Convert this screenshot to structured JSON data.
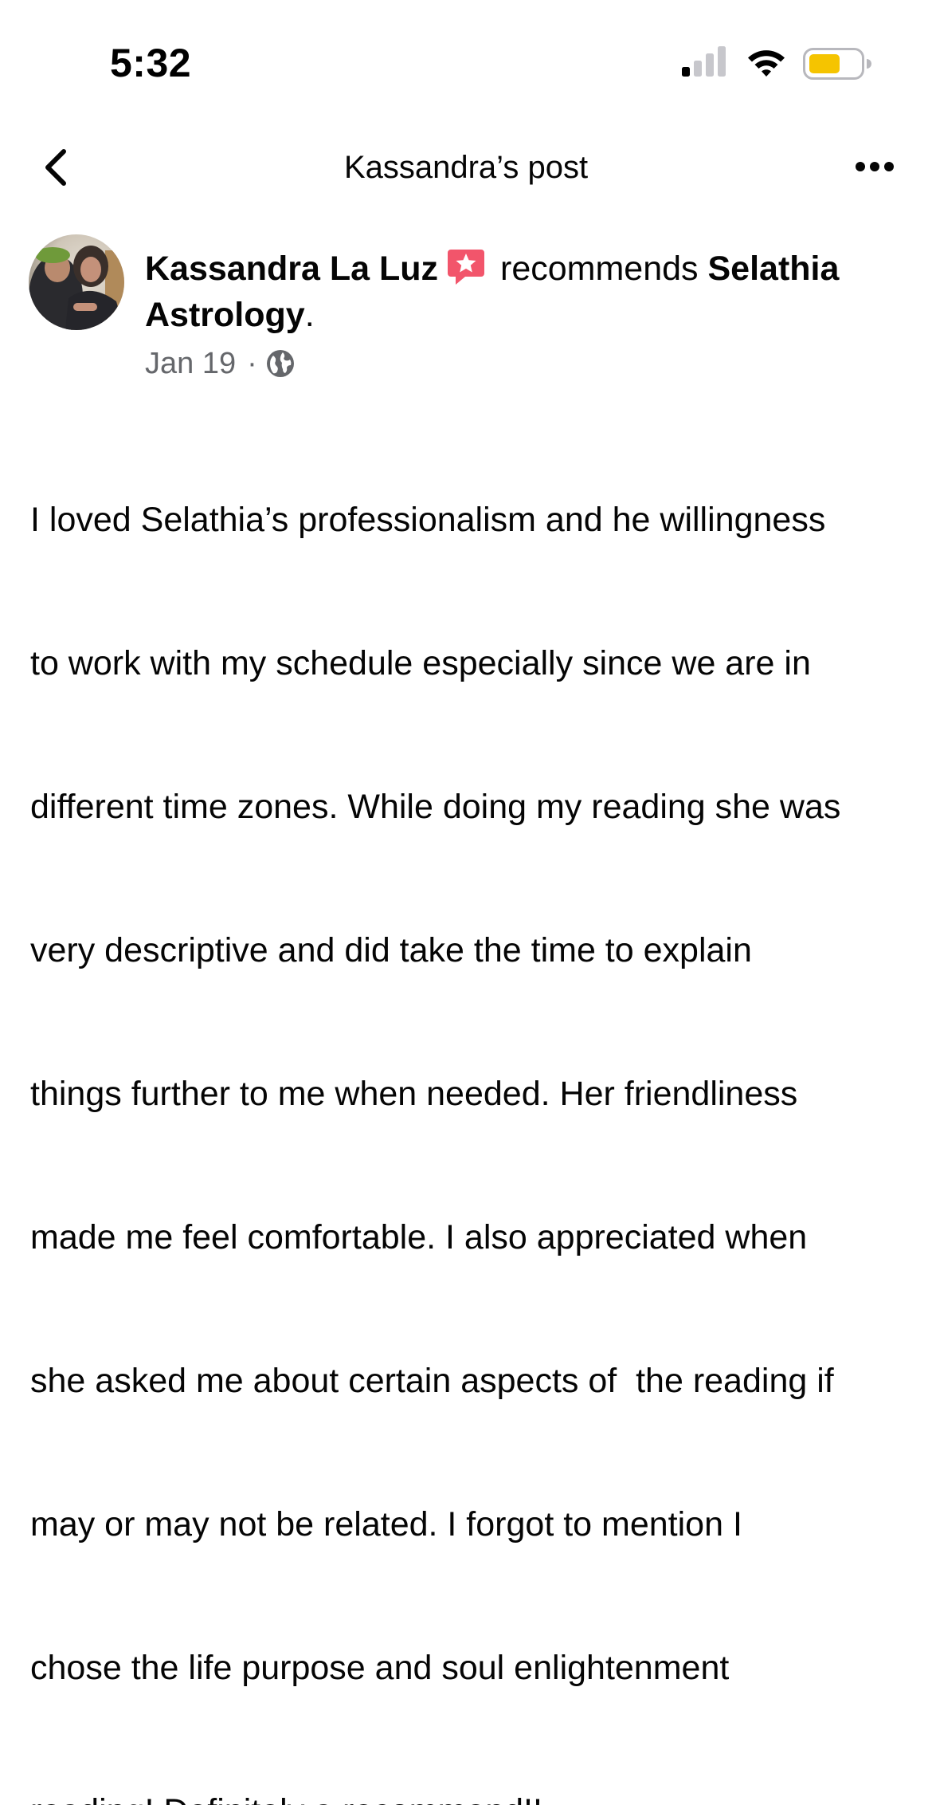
{
  "status_bar": {
    "time": "5:32",
    "battery_color": "#f5c400"
  },
  "nav": {
    "title": "Kassandra’s post",
    "back_icon": "chevron-left-icon",
    "more_icon": "more-horizontal-icon"
  },
  "post": {
    "author": "Kassandra La Luz",
    "verb": "recommends",
    "page_name": "Selathia Astrology",
    "period": ".",
    "badge_icon": "recommendation-star-icon",
    "badge_color": "#f2556b",
    "date": "Jan 19",
    "separator": "·",
    "privacy_icon": "globe-icon",
    "body_lines": [
      "I loved Selathia’s professionalism and he willingness",
      "to work with my schedule especially since we are in",
      "different time zones. While doing my reading she was",
      "very descriptive and did take the time to explain",
      "things further to me when needed. Her friendliness",
      "made me feel comfortable. I also appreciated when",
      "she asked me about certain aspects of  the reading if",
      "may or may not be related. I forgot to mention I",
      "chose the life purpose and soul enlightenment",
      "reading! Definitely a recommend!!"
    ]
  }
}
